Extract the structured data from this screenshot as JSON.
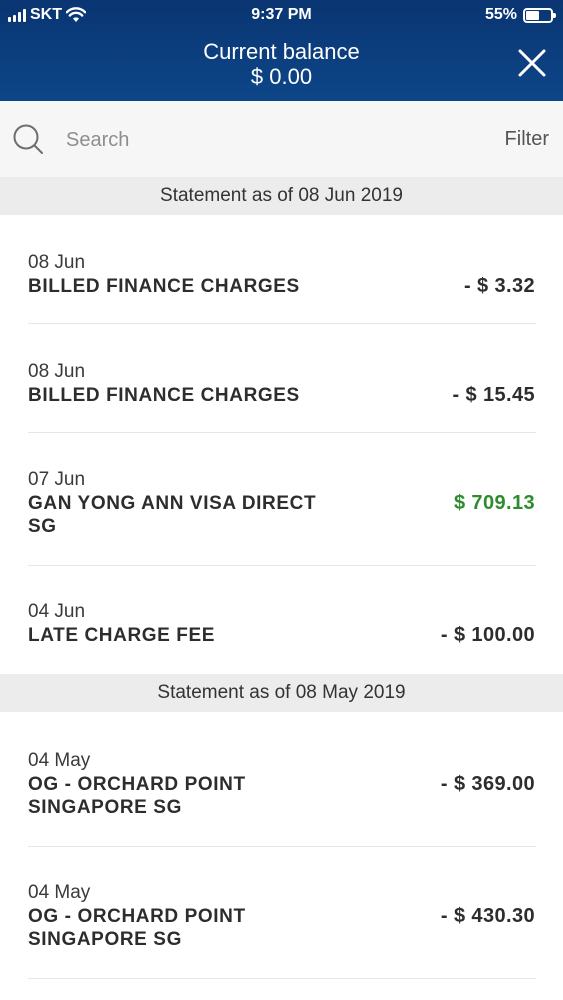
{
  "status_bar": {
    "carrier": "SKT",
    "time": "9:37 PM",
    "battery": "55%",
    "battery_level": 0.55
  },
  "header": {
    "title": "Current balance",
    "balance": "$ 0.00"
  },
  "search": {
    "placeholder": "Search",
    "filter_label": "Filter"
  },
  "statements": [
    {
      "title": "Statement as of 08 Jun 2019",
      "transactions": [
        {
          "date": "08 Jun",
          "description": "BILLED FINANCE CHARGES",
          "amount": "- $ 3.32",
          "type": "debit"
        },
        {
          "date": "08 Jun",
          "description": "BILLED FINANCE CHARGES",
          "amount": "- $ 15.45",
          "type": "debit"
        },
        {
          "date": "07 Jun",
          "description": "GAN YONG ANN VISA DIRECT SG",
          "amount": "$ 709.13",
          "type": "credit"
        },
        {
          "date": "04 Jun",
          "description": "LATE CHARGE FEE",
          "amount": "- $ 100.00",
          "type": "debit"
        }
      ]
    },
    {
      "title": "Statement as of 08 May 2019",
      "transactions": [
        {
          "date": "04 May",
          "description": "OG - ORCHARD POINT SINGAPORE SG",
          "amount": "- $ 369.00",
          "type": "debit"
        },
        {
          "date": "04 May",
          "description": "OG - ORCHARD POINT SINGAPORE SG",
          "amount": "- $ 430.30",
          "type": "debit"
        }
      ]
    }
  ],
  "colors": {
    "header_bg": "#0d4688",
    "credit": "#2e8b2e",
    "section_bg": "#ececec"
  },
  "icons": [
    "wifi-icon",
    "signal-icon",
    "battery-icon",
    "close-icon",
    "search-icon"
  ]
}
